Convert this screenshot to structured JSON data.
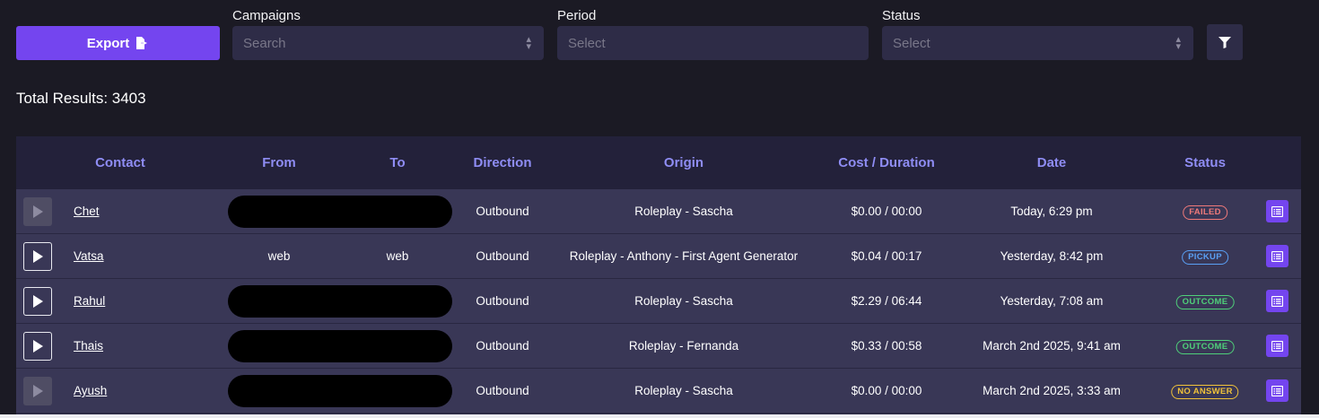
{
  "toolbar": {
    "export_label": "Export",
    "campaigns_label": "Campaigns",
    "campaigns_placeholder": "Search",
    "period_label": "Period",
    "period_placeholder": "Select",
    "status_label": "Status",
    "status_placeholder": "Select",
    "filter_icon": "filter-icon"
  },
  "summary": {
    "total_results": "Total Results: 3403"
  },
  "table": {
    "headers": {
      "contact": "Contact",
      "from": "From",
      "to": "To",
      "direction": "Direction",
      "origin": "Origin",
      "cost_duration": "Cost / Duration",
      "date": "Date",
      "status": "Status"
    },
    "rows": [
      {
        "contact": "Chet",
        "from": "",
        "to": "",
        "redacted": true,
        "direction": "Outbound",
        "origin": "Roleplay - Sascha",
        "cost_duration": "$0.00 / 00:00",
        "date": "Today, 6:29 pm",
        "status": "FAILED",
        "recording": false
      },
      {
        "contact": "Vatsa",
        "from": "web",
        "to": "web",
        "redacted": false,
        "direction": "Outbound",
        "origin": "Roleplay - Anthony - First Agent Generator",
        "cost_duration": "$0.04 / 00:17",
        "date": "Yesterday, 8:42 pm",
        "status": "PICKUP",
        "recording": true
      },
      {
        "contact": "Rahul",
        "from": "",
        "to": "",
        "redacted": true,
        "direction": "Outbound",
        "origin": "Roleplay - Sascha",
        "cost_duration": "$2.29 / 06:44",
        "date": "Yesterday, 7:08 am",
        "status": "OUTCOME",
        "recording": true
      },
      {
        "contact": "Thais",
        "from": "",
        "to": "",
        "redacted": true,
        "direction": "Outbound",
        "origin": "Roleplay - Fernanda",
        "cost_duration": "$0.33 / 00:58",
        "date": "March 2nd 2025, 9:41 am",
        "status": "OUTCOME",
        "recording": true
      },
      {
        "contact": "Ayush",
        "from": "",
        "to": "",
        "redacted": true,
        "direction": "Outbound",
        "origin": "Roleplay - Sascha",
        "cost_duration": "$0.00 / 00:00",
        "date": "March 2nd 2025, 3:33 am",
        "status": "NO ANSWER",
        "recording": false
      }
    ]
  },
  "colors": {
    "accent": "#7445ef",
    "header_text": "#8f8df4",
    "status_failed": "#f07a7a",
    "status_pickup": "#5aa0f5",
    "status_outcome": "#4fd07a",
    "status_no_answer": "#f0c23a"
  },
  "icons": {
    "export": "export-file-icon",
    "play": "play-icon",
    "notes": "notes-icon",
    "chevron": "chevron-updown-icon"
  }
}
